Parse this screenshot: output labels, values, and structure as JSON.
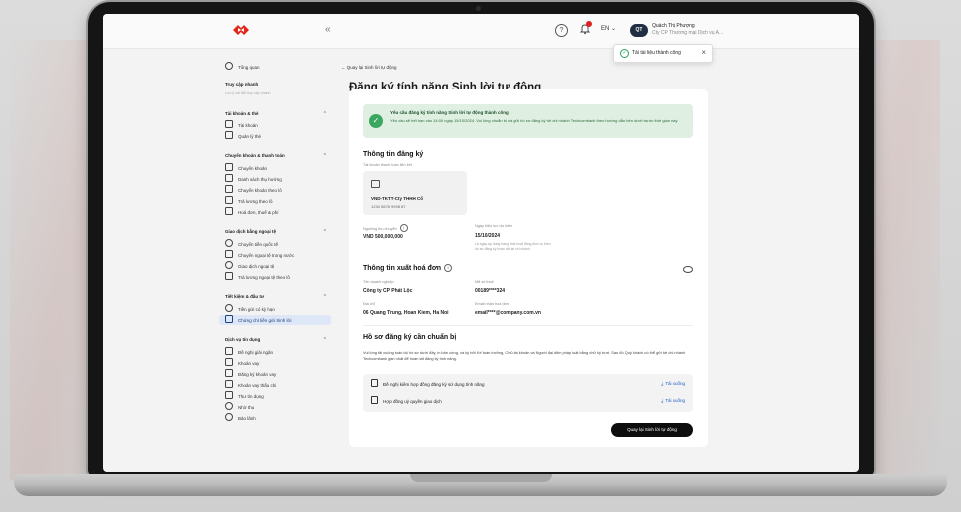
{
  "topbar": {
    "collapse_icon": "«",
    "help_icon": "?",
    "lang": "EN ⌄",
    "avatar_initials": "QT",
    "user_name": "Quách Thị Phượng",
    "user_sub": "Cty CP Thương mại Dịch vụ A..."
  },
  "toast": {
    "message": "Tải tài liệu thành công",
    "close": "×"
  },
  "sidebar": {
    "overview": "Tổng quan",
    "quick_access": "Truy cập nhanh",
    "quick_access_sub": "Lưu ý cài đặt truy cập nhanh",
    "groups": [
      {
        "title": "Tài khoản & thẻ",
        "items": [
          "Tài khoản",
          "Quản lý thẻ"
        ]
      },
      {
        "title": "Chuyển khoản & thanh toán",
        "items": [
          "Chuyển khoản",
          "Danh sách thụ hưởng",
          "Chuyển khoản theo lô",
          "Trả lương theo lô",
          "Hoá đơn, thuế & phí"
        ]
      },
      {
        "title": "Giao dịch bằng ngoại tệ",
        "items": [
          "Chuyển tiền quốc tế",
          "Chuyển ngoại tệ trong nước",
          "Giao dịch ngoại tệ",
          "Trả lương ngoại tệ theo lô"
        ]
      },
      {
        "title": "Tiết kiệm & đầu tư",
        "items": [
          "Tiền gửi có kỳ hạn",
          "Chứng chỉ tiền gửi Sinh lời"
        ]
      },
      {
        "title": "Dịch vụ tín dụng",
        "items": [
          "Đề nghị giải ngân",
          "Khoản vay",
          "Đăng ký khoản vay",
          "Khoản vay thấu chi",
          "Thư tín dụng",
          "Nhờ thu",
          "Bảo lãnh"
        ]
      }
    ],
    "chevron": "⌃"
  },
  "main": {
    "back_label": "←  Quay lại Sinh lời tự động",
    "page_title": "Đăng ký tính năng Sinh lời tự động"
  },
  "success": {
    "check": "✓",
    "title": "Yêu cầu đăng ký tính năng Sinh lời tự động thành công",
    "body": "Yêu cầu sẽ hết hạn vào 14:00 ngày 15/10/2024. Vui lòng chuẩn bị và gửi hồ sơ đăng ký tới chi nhánh Techcombank theo hướng dẫn bên dưới trước thời gian này."
  },
  "registration": {
    "section_title": "Thông tin đăng ký",
    "account_label": "Tài khoản thanh toán liên kết",
    "account_name": "VND-TKTT-Cty THHH Cổ",
    "account_number": "1234 5678 9998 87",
    "min_amount_label": "Ngưỡng thu chuyển",
    "min_amount_value": "VND 500,000,000",
    "effective_label": "Ngày hiệu lực dự kiến",
    "effective_value": "15/10/2024",
    "effective_note": "Là ngày áp dụng trạng thái hoạt động dịch vụ theo hồ sơ đăng ký hoàn tất tại chi nhánh."
  },
  "invoice": {
    "section_title": "Thông tin xuất hoá đơn",
    "company_label": "Tên doanh nghiệp",
    "company_value": "Công ty CP Phát Lộc",
    "tax_label": "Mã số thuế",
    "tax_value": "00189****324",
    "address_label": "Địa chỉ",
    "address_value": "06 Quang Trung, Hoan Kiem, Ha Noi",
    "email_label": "Email nhận hoá đơn",
    "email_value": "email****@company.com.vn"
  },
  "documents": {
    "section_title": "Hồ sơ đăng ký cần chuẩn bị",
    "intro": "Vui lòng tải xuống toàn bộ hồ sơ dưới đây, in bản cứng, và ký bởi Kế toán trưởng, Chủ tài khoản và Người đại diện pháp luật bằng chữ ký tươi. Sau đó Quý khách có thể gửi tới chi nhánh Techcombank gần nhất để hoàn tất đăng ký tính năng.",
    "items": [
      {
        "name": "Đề nghị kiêm hợp đồng đăng ký sử dụng tính năng",
        "action": "Tải xuống"
      },
      {
        "name": "Hợp đồng uỷ quyền giao dịch",
        "action": "Tải xuống"
      }
    ],
    "download_icon": "⤓"
  },
  "primary_button": "Quay lại Sinh lời tự động"
}
